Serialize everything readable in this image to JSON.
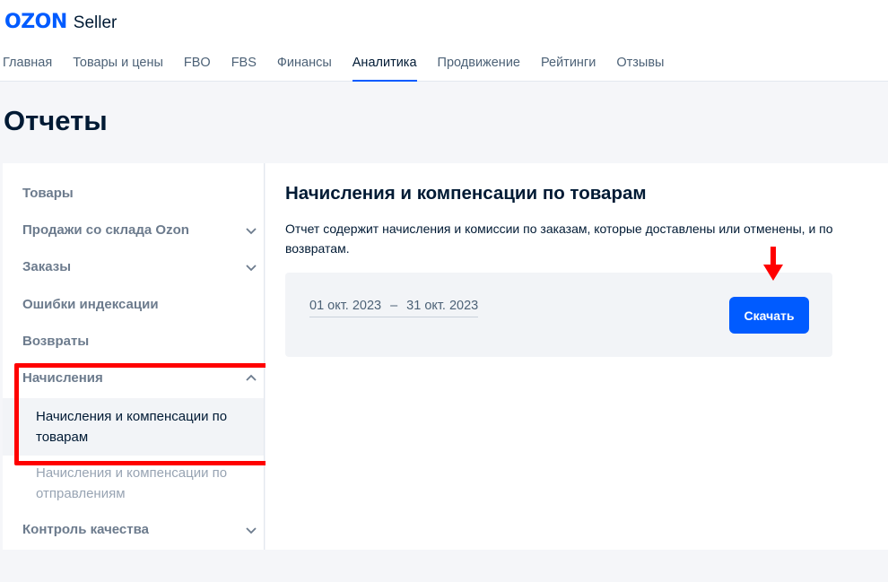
{
  "header": {
    "logo_brand": "OZON",
    "logo_suffix": "Seller",
    "nav": [
      {
        "label": "Главная",
        "active": false
      },
      {
        "label": "Товары и цены",
        "active": false
      },
      {
        "label": "FBO",
        "active": false
      },
      {
        "label": "FBS",
        "active": false
      },
      {
        "label": "Финансы",
        "active": false
      },
      {
        "label": "Аналитика",
        "active": true
      },
      {
        "label": "Продвижение",
        "active": false
      },
      {
        "label": "Рейтинги",
        "active": false
      },
      {
        "label": "Отзывы",
        "active": false
      }
    ]
  },
  "page_title": "Отчеты",
  "sidebar": {
    "items": [
      {
        "label": "Товары",
        "icon": null
      },
      {
        "label": "Продажи со склада Ozon",
        "icon": "chevron-down-icon"
      },
      {
        "label": "Заказы",
        "icon": "chevron-down-icon"
      },
      {
        "label": "Ошибки индексации",
        "icon": null
      },
      {
        "label": "Возвраты",
        "icon": null
      },
      {
        "label": "Начисления",
        "icon": "chevron-up-icon"
      },
      {
        "label": "Контроль качества",
        "icon": "chevron-down-icon"
      }
    ],
    "subitems": [
      {
        "label": "Начисления и компенсации по товарам",
        "active": true
      },
      {
        "label": "Начисления и компенсации по отправлениям",
        "active": false
      }
    ]
  },
  "content": {
    "title": "Начисления и компенсации по товарам",
    "description": "Отчет содержит начисления и комиссии по заказам, которые доставлены или отменены, и по возвратам.",
    "date_from": "01 окт. 2023",
    "date_separator": "–",
    "date_to": "31 окт. 2023",
    "download_label": "Скачать"
  },
  "colors": {
    "brand": "#005bff",
    "annotation": "#ff0000",
    "page_background": "#f5f6f9"
  }
}
